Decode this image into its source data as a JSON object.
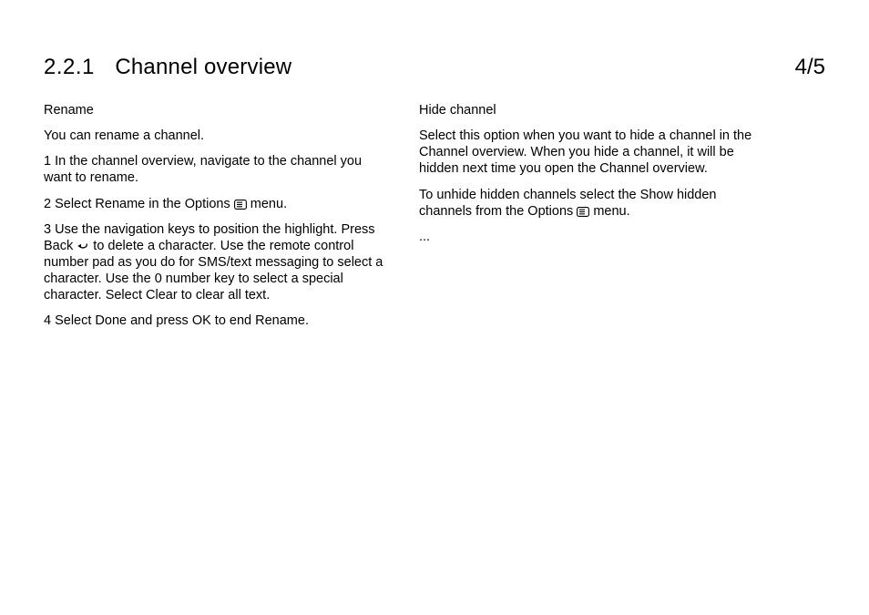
{
  "header": {
    "section_number": "2.2.1",
    "section_title": "Channel overview",
    "page_indicator": "4/5"
  },
  "left_column": {
    "heading": "Rename",
    "p1": "You can rename a channel.",
    "p2": "1 In the channel overview, navigate to the channel you want to rename.",
    "p3_before_icon": "2 Select Rename in the Options ",
    "p3_after_icon": " menu.",
    "p4_before_icon": "3 Use the navigation keys to position the highlight. Press Back ",
    "p4_after_icon": " to delete a character. Use the remote control number pad as you do for SMS/text messaging to select a character. Use the 0 number key to select a special character. Select Clear to clear all text.",
    "p5": "4 Select Done and press OK to end Rename."
  },
  "right_column": {
    "heading": "Hide channel",
    "p1": "Select this option when you want to hide a channel in the Channel overview. When you hide a channel, it will be hidden next time you open the Channel overview.",
    "p2_before_icon": "To unhide hidden channels select the Show hidden channels from the Options ",
    "p2_after_icon": " menu.",
    "p3": "..."
  }
}
